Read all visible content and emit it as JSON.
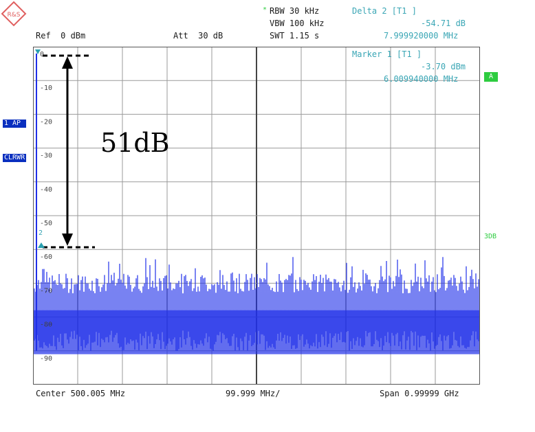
{
  "header": {
    "rbw": "RBW 30 kHz",
    "vbw": "VBW 100 kHz",
    "swt": "SWT 1.15 s",
    "ref": "Ref  0 dBm",
    "att": "Att  30 dB",
    "star": "*"
  },
  "marker_delta": {
    "title": "Delta 2 [T1 ]",
    "level": "-54.71 dB",
    "freq": "7.999920000 MHz"
  },
  "marker_1": {
    "title": "Marker 1 [T1 ]",
    "level": "-3.70 dBm",
    "freq": "6.009940000 MHz"
  },
  "side_labels": {
    "trace_mode_1": "1 AP",
    "trace_mode_2": "CLRWR",
    "badge_a": "A",
    "label_3db": "3DB",
    "marker2_num": "2"
  },
  "y_ticks": [
    "0",
    "-10",
    "-20",
    "-30",
    "-40",
    "-50",
    "-60",
    "-70",
    "-80",
    "-90"
  ],
  "annotation": {
    "label": "51dB"
  },
  "footer": {
    "center": "Center 500.005 MHz",
    "per_div": "99.999 MHz/",
    "span": "Span 0.99999 GHz"
  },
  "colors": {
    "trace": "#1f2fe8",
    "grid": "#9a9a9a",
    "marker": "#2aa0b0",
    "badge_bg": "#2ecc40",
    "trace_box": "#0a2fbf"
  },
  "logo": {
    "text": "R&S"
  }
}
